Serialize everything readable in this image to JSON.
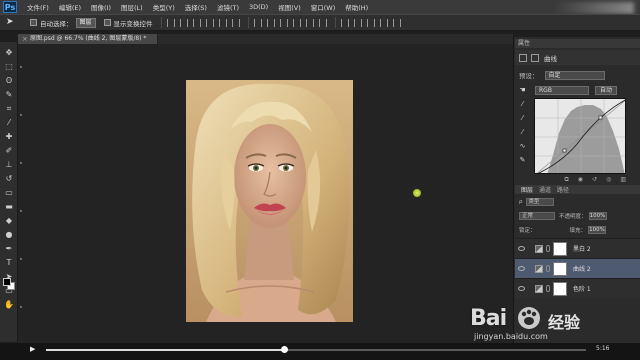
{
  "app": {
    "logo": "Ps",
    "menu": [
      "文件(F)",
      "编辑(E)",
      "图像(I)",
      "图层(L)",
      "类型(Y)",
      "选择(S)",
      "滤镜(T)",
      "3D(D)",
      "视图(V)",
      "窗口(W)",
      "帮助(H)"
    ]
  },
  "options": {
    "auto_select_label": "自动选择：",
    "auto_select_value": "图层",
    "transform_label": "显示变换控件"
  },
  "document": {
    "tab_title": "原图.psd @ 66.7% (曲线 2, 图层蒙版/8) *"
  },
  "properties": {
    "header": "属性",
    "title": "曲线",
    "preset_label": "预设：",
    "preset_value": "自定",
    "channel_value": "RGB",
    "auto_label": "自动"
  },
  "layers_panel": {
    "tabs": [
      "图层",
      "通道",
      "路径"
    ],
    "type_filter": "类型",
    "blend_mode": "正常",
    "opacity_label": "不透明度：",
    "opacity_value": "100%",
    "lock_label": "锁定：",
    "fill_label": "填充：",
    "fill_value": "100%",
    "layers": [
      {
        "name": "黑白 2",
        "selected": false
      },
      {
        "name": "曲线 2",
        "selected": true
      },
      {
        "name": "色阶 1",
        "selected": false
      }
    ]
  },
  "video": {
    "time": "5:16",
    "progress": 0.44
  },
  "watermark": {
    "logo": "Bai",
    "brand": "经验",
    "url": "jingyan.baidu.com"
  }
}
